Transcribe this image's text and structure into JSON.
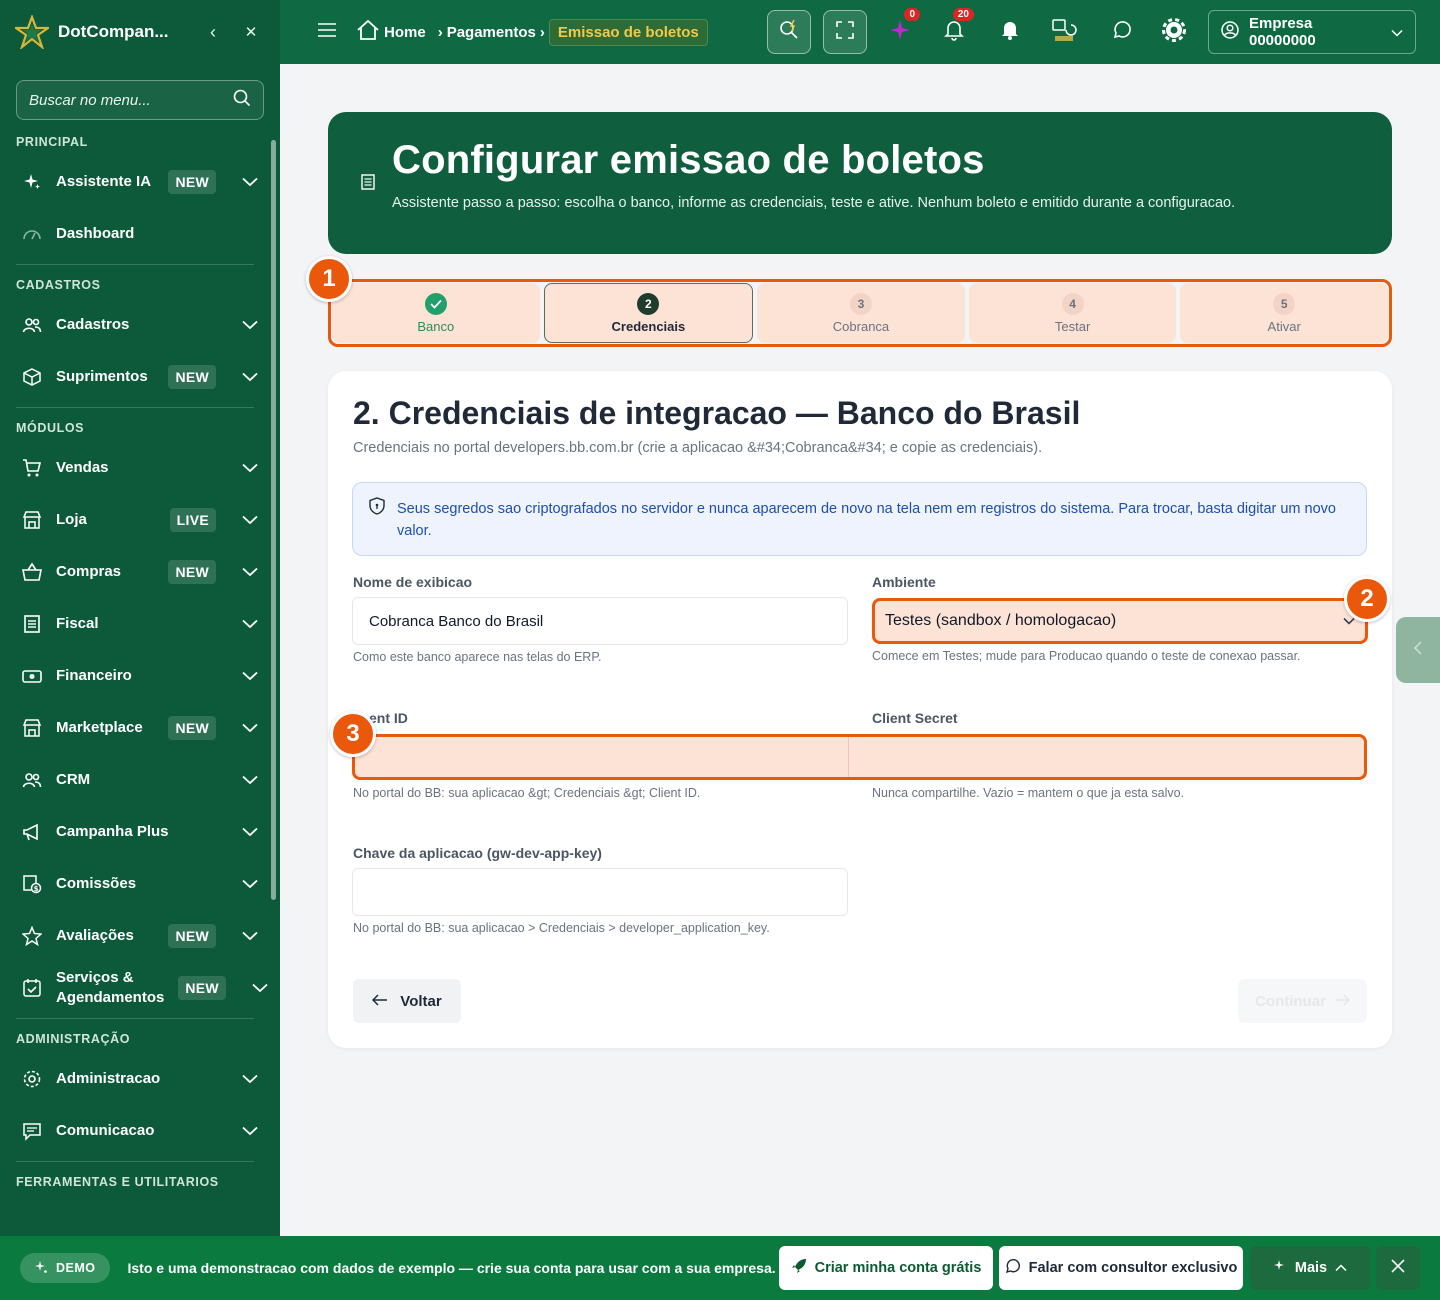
{
  "sidebar": {
    "brand": "DotCompan...",
    "search_placeholder": "Buscar no menu...",
    "sections": {
      "principal": "PRINCIPAL",
      "cadastros": "CADASTROS",
      "modulos": "MÓDULOS",
      "administracao": "ADMINISTRAÇÃO",
      "ferramentas": "FERRAMENTAS E UTILITARIOS"
    },
    "items": {
      "assistente": {
        "label": "Assistente IA",
        "badge": "NEW"
      },
      "dashboard": {
        "label": "Dashboard"
      },
      "cadastros": {
        "label": "Cadastros"
      },
      "suprimentos": {
        "label": "Suprimentos",
        "badge": "NEW"
      },
      "vendas": {
        "label": "Vendas"
      },
      "loja": {
        "label": "Loja",
        "badge": "LIVE"
      },
      "compras": {
        "label": "Compras",
        "badge": "NEW"
      },
      "fiscal": {
        "label": "Fiscal"
      },
      "financeiro": {
        "label": "Financeiro"
      },
      "marketplace": {
        "label": "Marketplace",
        "badge": "NEW"
      },
      "crm": {
        "label": "CRM"
      },
      "campanha": {
        "label": "Campanha Plus"
      },
      "comissoes": {
        "label": "Comissões"
      },
      "avaliacoes": {
        "label": "Avaliações",
        "badge": "NEW"
      },
      "servicos": {
        "label1": "Serviços &",
        "label2": "Agendamentos",
        "badge": "NEW"
      },
      "administracao": {
        "label": "Administracao"
      },
      "comunicacao": {
        "label": "Comunicacao"
      }
    }
  },
  "topbar": {
    "breadcrumbs": [
      "Home",
      "Pagamentos",
      "Emissao de boletos"
    ],
    "notif_ai_count": "0",
    "notif_bell_count": "20",
    "company": "Empresa 00000000"
  },
  "hero": {
    "title": "Configurar emissao de boletos",
    "subtitle": "Assistente passo a passo: escolha o banco, informe as credenciais, teste e ative. Nenhum boleto e emitido durante a configuracao."
  },
  "steps": [
    {
      "num": "1",
      "label": "Banco",
      "state": "done"
    },
    {
      "num": "2",
      "label": "Credenciais",
      "state": "current"
    },
    {
      "num": "3",
      "label": "Cobranca",
      "state": "pending"
    },
    {
      "num": "4",
      "label": "Testar",
      "state": "pending"
    },
    {
      "num": "5",
      "label": "Ativar",
      "state": "pending"
    }
  ],
  "markers": [
    "1",
    "2",
    "3"
  ],
  "form": {
    "title": "2. Credenciais de integracao — Banco do Brasil",
    "subtitle": "Credenciais no portal developers.bb.com.br (crie a aplicacao &#34;Cobranca&#34; e copie as credenciais).",
    "notice": "Seus segredos sao criptografados no servidor e nunca aparecem de novo na tela nem em registros do sistema. Para trocar, basta digitar um novo valor.",
    "nome": {
      "label": "Nome de exibicao",
      "value": "Cobranca Banco do Brasil",
      "help": "Como este banco aparece nas telas do ERP."
    },
    "ambiente": {
      "label": "Ambiente",
      "value": "Testes (sandbox / homologacao)",
      "help": "Comece em Testes; mude para Producao quando o teste de conexao passar."
    },
    "client_id": {
      "label": "ent ID",
      "value": "",
      "help": "No portal do BB: sua aplicacao &gt; Credenciais &gt; Client ID."
    },
    "client_secret": {
      "label": "Client Secret",
      "value": "",
      "help": "Nunca compartilhe. Vazio = mantem o que ja esta salvo."
    },
    "app_key": {
      "label": "Chave da aplicacao (gw-dev-app-key)",
      "value": "",
      "help": "No portal do BB: sua aplicacao > Credenciais > developer_application_key."
    },
    "back_label": "Voltar",
    "next_label": "Continuar"
  },
  "demobar": {
    "pill": "DEMO",
    "message": "Isto e uma demonstracao com dados de exemplo — crie sua conta para usar com a sua empresa.",
    "create_account": "Criar minha conta grátis",
    "consultant": "Falar com consultor exclusivo",
    "more": "Mais"
  },
  "colors": {
    "sidebar": "#0d5a3a",
    "topbar": "#0f6a44",
    "accent": "#ea580c",
    "highlight": "#fde2d6"
  }
}
